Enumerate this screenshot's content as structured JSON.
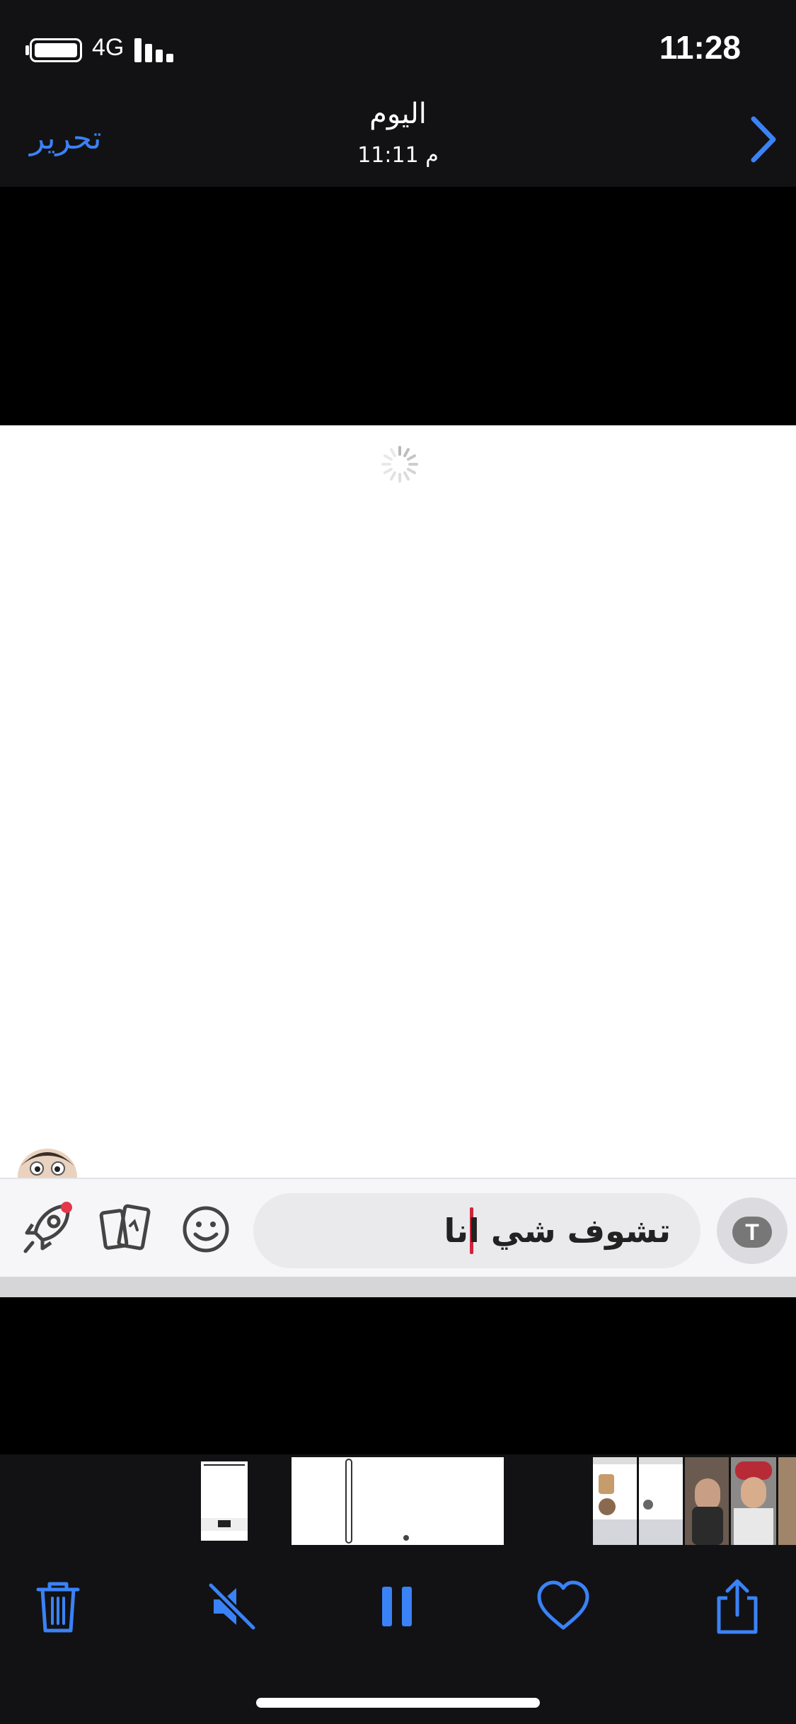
{
  "status_bar": {
    "time": "11:28",
    "network": "4G",
    "icons": [
      "battery-icon",
      "signal-icon"
    ]
  },
  "nav_bar": {
    "title": "اليوم",
    "subtitle": "11:11 م",
    "edit_label": "تحرير",
    "forward_icon": "chevron-right-icon"
  },
  "content": {
    "message_input_text": "تشوف شي انا",
    "text_button_glyph": "T",
    "icons": [
      "loading-spinner-icon",
      "memoji-icon",
      "rocket-icon",
      "cards-icon",
      "smiley-icon",
      "text-style-icon"
    ]
  },
  "toolbar": {
    "items": [
      "trash-icon",
      "mute-icon",
      "pause-icon",
      "heart-icon",
      "share-icon"
    ]
  },
  "colors": {
    "accent": "#3a82f7",
    "bar_background": "#121214",
    "cursor": "#d0243a"
  }
}
